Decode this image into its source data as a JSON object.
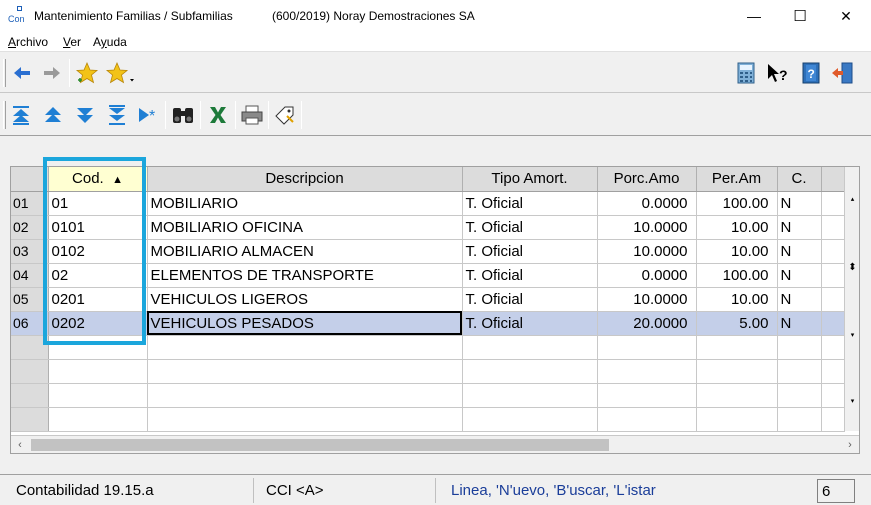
{
  "window": {
    "app_icon_label": "Con",
    "title": "Mantenimiento Familias / Subfamilias",
    "subtitle": "(600/2019) Noray Demostraciones SA",
    "minimize": "—",
    "maximize": "☐",
    "close": "✕"
  },
  "menu": {
    "items": [
      {
        "label": "Archivo",
        "hotkey": "A"
      },
      {
        "label": "Ver",
        "hotkey": "V"
      },
      {
        "label": "Ayuda",
        "hotkey": "y"
      }
    ]
  },
  "toolbar1": {
    "icons": [
      "back-arrow-icon",
      "forward-arrow-icon",
      "favorite-add-star-icon",
      "favorites-star-dropdown-icon",
      "calculator-icon",
      "help-pointer-icon",
      "help-book-icon",
      "exit-door-icon"
    ],
    "help_text": "?",
    "colors": {
      "arrow_back": "#2a6fd1",
      "arrow_forward": "#9a9a9a",
      "star": "#f2c318"
    }
  },
  "toolbar2": {
    "icons": [
      "first-record-icon",
      "previous-page-icon",
      "next-page-icon",
      "last-record-icon",
      "new-record-icon",
      "search-binoculars-icon",
      "excel-icon",
      "print-icon",
      "edit-tag-icon"
    ],
    "new_mark": "*",
    "colors": {
      "nav": "#1f7fd4",
      "excel": "#1d7a3a"
    }
  },
  "grid": {
    "columns": [
      {
        "key": "cod",
        "label": "Cod.",
        "sorted": true
      },
      {
        "key": "descripcion",
        "label": "Descripcion"
      },
      {
        "key": "tipo",
        "label": "Tipo Amort."
      },
      {
        "key": "porc",
        "label": "Porc.Amo"
      },
      {
        "key": "per",
        "label": "Per.Am"
      },
      {
        "key": "c",
        "label": "C."
      }
    ],
    "sort_indicator": "▲",
    "rows": [
      {
        "n": "01",
        "cod": "01",
        "descripcion": "MOBILIARIO",
        "tipo": "T. Oficial",
        "porc": "0.0000",
        "per": "100.00",
        "c": "N"
      },
      {
        "n": "02",
        "cod": "0101",
        "descripcion": "MOBILIARIO OFICINA",
        "tipo": "T. Oficial",
        "porc": "10.0000",
        "per": "10.00",
        "c": "N"
      },
      {
        "n": "03",
        "cod": "0102",
        "descripcion": "MOBILIARIO ALMACEN",
        "tipo": "T. Oficial",
        "porc": "10.0000",
        "per": "10.00",
        "c": "N"
      },
      {
        "n": "04",
        "cod": "02",
        "descripcion": "ELEMENTOS DE TRANSPORTE",
        "tipo": "T. Oficial",
        "porc": "0.0000",
        "per": "100.00",
        "c": "N"
      },
      {
        "n": "05",
        "cod": "0201",
        "descripcion": "VEHICULOS LIGEROS",
        "tipo": "T. Oficial",
        "porc": "10.0000",
        "per": "10.00",
        "c": "N"
      },
      {
        "n": "06",
        "cod": "0202",
        "descripcion": "VEHICULOS PESADOS",
        "tipo": "T. Oficial",
        "porc": "20.0000",
        "per": "5.00",
        "c": "N"
      }
    ],
    "selected_row": 5,
    "empty_rows": 4,
    "colors": {
      "selected_row": "#c4cfe9",
      "sorted_header": "#ffffd2",
      "highlight_box": "#1ba6dc"
    },
    "vscroll": {
      "up": "▴",
      "mid": "⬍",
      "down": "▾"
    },
    "hscroll": {
      "left": "‹",
      "right": "›"
    }
  },
  "status": {
    "app": "Contabilidad 19.15.a",
    "user": "CCI <A>",
    "hint": "Linea, 'N'uevo, 'B'uscar, 'L'istar",
    "count": "6",
    "colors": {
      "hint": "#1a3d99"
    }
  }
}
